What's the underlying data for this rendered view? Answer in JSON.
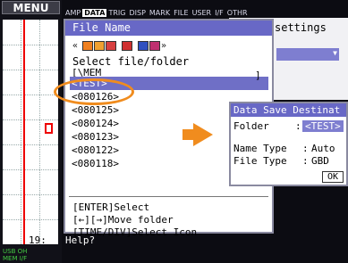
{
  "menu": {
    "label": "MENU"
  },
  "tabs": [
    {
      "label": "AMP",
      "active": false
    },
    {
      "label": "DATA",
      "active": true
    },
    {
      "label": "TRIG",
      "active": false
    },
    {
      "label": "DISP",
      "active": false
    },
    {
      "label": "MARK",
      "active": false
    },
    {
      "label": "FILE",
      "active": false
    },
    {
      "label": "USER",
      "active": false
    },
    {
      "label": "I/F",
      "active": false
    },
    {
      "label": "OTHR",
      "active": false
    }
  ],
  "background_panel": {
    "title": "settings"
  },
  "waveform": {
    "time_label": "19:"
  },
  "status_strip": {
    "line1": "USB  OH",
    "line2": "MEM  I/F"
  },
  "file_dialog": {
    "title": "File Name",
    "select_label": "Select file/folder",
    "toolbar_icons": [
      "prev-arrow-icon",
      "folder-up-icon",
      "folder-icon",
      "folder-red-icon",
      "delete-icon",
      "save-icon",
      "new-folder-icon",
      "next-arrow-icon"
    ],
    "path_row": "[\\MEM",
    "path_row_end": "]",
    "items": [
      "<TEST>",
      "<080126>",
      "<080125>",
      "<080124>",
      "<080123>",
      "<080122>",
      "<080118>"
    ],
    "selected_index": 0,
    "help": [
      "[ENTER]Select",
      "[←][→]Move folder",
      "[TIME/DIV]Select Icon"
    ]
  },
  "help_bar": {
    "text": "Help?"
  },
  "save_dialog": {
    "title": "Data Save Destinat",
    "folder_label": "Folder",
    "folder_value": "<TEST>",
    "name_type_label": "Name Type",
    "name_type_value": "Auto",
    "file_type_label": "File Type",
    "file_type_value": "GBD",
    "ok_label": "OK",
    "separator": ":"
  },
  "colors": {
    "accent": "#6868c6",
    "highlight": "#f08c1e",
    "selection": "#6f6fc6",
    "trace": "#ee0000"
  }
}
